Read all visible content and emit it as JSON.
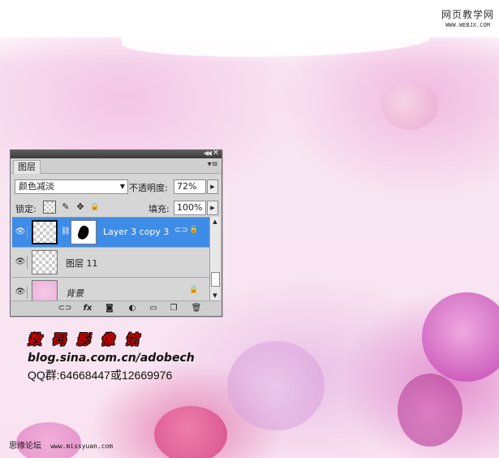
{
  "watermark": {
    "site_name": "网页教学网",
    "site_url": "WWW.WEBJX.COM"
  },
  "layers_panel": {
    "title_collapse_icon": "collapse-icon",
    "title_close_icon": "close-icon",
    "tab_label": "图层",
    "panel_menu_icon": "panel-menu-icon",
    "blend_mode": "颜色减淡",
    "opacity_label": "不透明度:",
    "opacity_value": "72%",
    "lock_label": "锁定:",
    "fill_label": "填充:",
    "fill_value": "100%",
    "layers": [
      {
        "name": "Layer 3 copy 3",
        "selected": true,
        "visible": true,
        "has_mask": true
      },
      {
        "name": "图层 11",
        "selected": false,
        "visible": true,
        "has_mask": false
      },
      {
        "name": "背景",
        "selected": false,
        "visible": true,
        "has_mask": false,
        "locked": true
      }
    ],
    "bottom_icons": [
      "link-layers-icon",
      "fx-icon",
      "add-mask-icon",
      "adjustment-layer-icon",
      "new-group-icon",
      "new-layer-icon",
      "delete-layer-icon"
    ],
    "fx_label": "fx"
  },
  "credits": {
    "title": "数码影像馆",
    "blog": "blog.sina.com.cn/adobech",
    "qq": "QQ群:64668447或12669976"
  },
  "footer": {
    "forum": "思缘论坛",
    "url": "www.missyuan.com"
  },
  "colors": {
    "selected_layer": "#3d8ce8",
    "credits_title": "#d10000"
  }
}
